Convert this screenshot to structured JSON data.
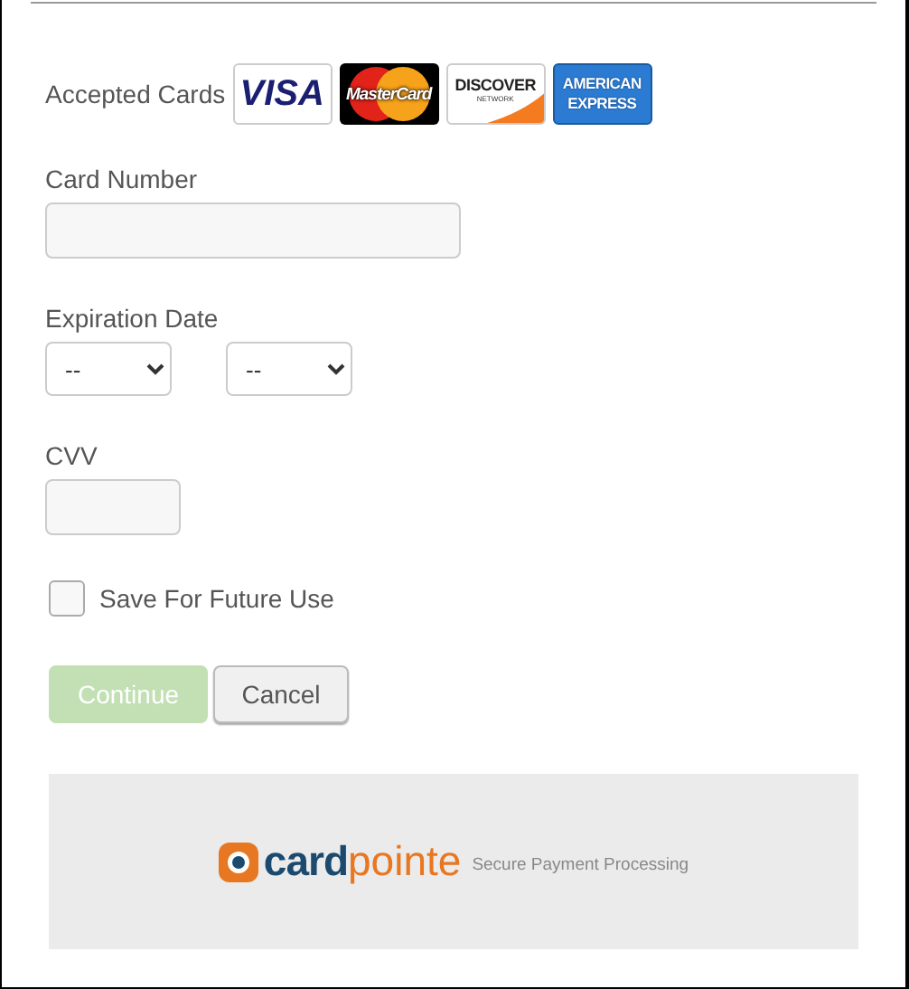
{
  "accepted_cards": {
    "label": "Accepted Cards",
    "cards": [
      {
        "kind": "visa",
        "texts": [
          "VISA"
        ]
      },
      {
        "kind": "mastercard",
        "texts": [
          "MasterCard"
        ]
      },
      {
        "kind": "discover",
        "texts": [
          "DISCOVER",
          "NETWORK"
        ]
      },
      {
        "kind": "amex",
        "texts": [
          "AMERICAN",
          "EXPRESS"
        ]
      }
    ]
  },
  "card_number": {
    "label": "Card Number"
  },
  "expiration": {
    "label": "Expiration Date",
    "month": "--",
    "year": "--"
  },
  "cvv": {
    "label": "CVV"
  },
  "save": {
    "label": "Save For Future Use",
    "checked": false
  },
  "buttons": [
    {
      "label": "Continue",
      "disabled": true,
      "kind": "primary"
    },
    {
      "label": "Cancel",
      "disabled": false,
      "kind": "secondary"
    }
  ],
  "footer": {
    "brand_1": "card",
    "brand_2": "pointe",
    "tagline": "Secure Payment Processing"
  }
}
